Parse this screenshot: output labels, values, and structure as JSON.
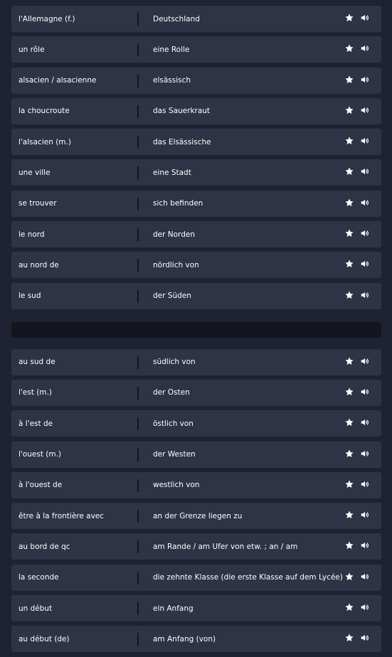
{
  "cards_top": [
    {
      "term": "l'Allemagne (f.)",
      "definition": "Deutschland"
    },
    {
      "term": "un rôle",
      "definition": "eine Rolle"
    },
    {
      "term": "alsacien / alsacienne",
      "definition": "elsässisch"
    },
    {
      "term": "la choucroute",
      "definition": "das Sauerkraut"
    },
    {
      "term": "l'alsacien (m.)",
      "definition": "das Elsässische"
    },
    {
      "term": "une ville",
      "definition": "eine Stadt"
    },
    {
      "term": "se trouver",
      "definition": "sich befinden"
    },
    {
      "term": "le nord",
      "definition": "der Norden"
    },
    {
      "term": "au nord de",
      "definition": "nördlich von"
    },
    {
      "term": "le sud",
      "definition": "der Süden"
    }
  ],
  "cards_bottom": [
    {
      "term": "au sud de",
      "definition": "südlich von"
    },
    {
      "term": "l'est (m.)",
      "definition": "der Osten"
    },
    {
      "term": "à l'est de",
      "definition": "östlich von"
    },
    {
      "term": "l'ouest (m.)",
      "definition": "der Westen"
    },
    {
      "term": "à l'ouest de",
      "definition": "westlich von"
    },
    {
      "term": "être à la frontière avec",
      "definition": "an der Grenze liegen zu"
    },
    {
      "term": "au bord de qc",
      "definition": "am Rande / am Ufer von etw. ; an / am"
    },
    {
      "term": "la seconde",
      "definition": "die zehnte Klasse (die erste Klasse auf dem Lycée)"
    },
    {
      "term": "un début",
      "definition": "ein Anfang"
    },
    {
      "term": "au début (de)",
      "definition": "am Anfang (von)"
    }
  ],
  "icons": {
    "star": "star-icon",
    "audio": "speaker-icon"
  },
  "colors": {
    "background": "#1f2232",
    "card": "#2e3346",
    "divider": "#14161f",
    "text": "#ffffff"
  }
}
